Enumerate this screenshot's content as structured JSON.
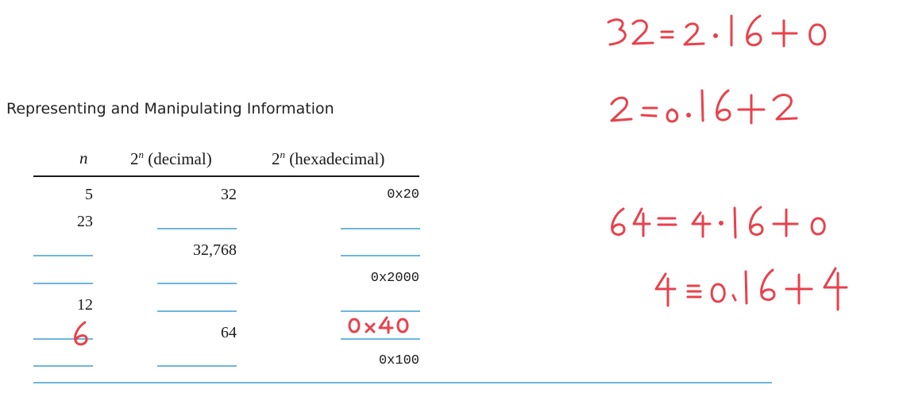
{
  "heading": "Representing and Manipulating Information",
  "table": {
    "headers": {
      "n": "n",
      "decimal_base": "2",
      "decimal_sup": "n",
      "decimal_rest": " (decimal)",
      "hex_base": "2",
      "hex_sup": "n",
      "hex_rest": " (hexadecimal)"
    },
    "rows": [
      {
        "n": "5",
        "decimal": "32",
        "hex": "0x20"
      },
      {
        "n": "23",
        "decimal": "",
        "hex": ""
      },
      {
        "n": "",
        "decimal": "32,768",
        "hex": ""
      },
      {
        "n": "",
        "decimal": "",
        "hex": "0x2000"
      },
      {
        "n": "12",
        "decimal": "",
        "hex": ""
      },
      {
        "n": "6",
        "decimal": "64",
        "hex": "0x40"
      },
      {
        "n": "",
        "decimal": "",
        "hex": "0x100"
      }
    ]
  },
  "handwriting": {
    "color": "#e8414c",
    "row6_n": "6",
    "row6_hex": "0x40",
    "note1": "32=2·16+0",
    "note2": "2=0·16+2",
    "note3": "64=4·16+0",
    "note4": "4=0·16+4"
  }
}
